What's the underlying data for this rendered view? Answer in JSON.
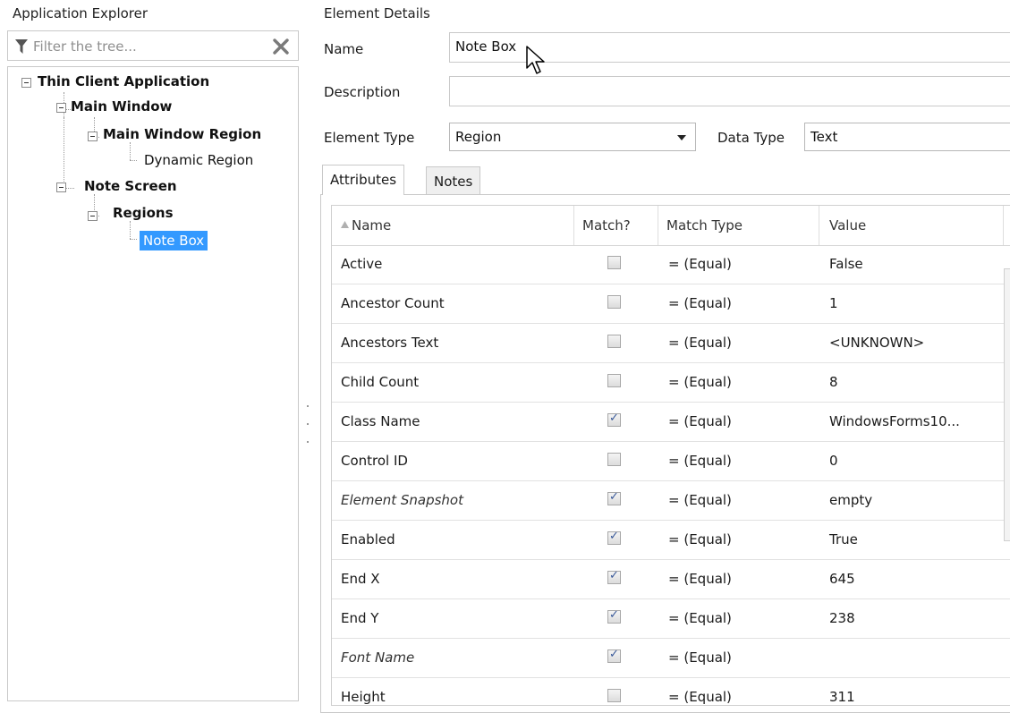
{
  "left_panel": {
    "title": "Application Explorer",
    "filter_placeholder": "Filter the tree...",
    "tree": [
      {
        "label": "Thin Client Application",
        "bold": true,
        "level": 0,
        "expanded": true
      },
      {
        "label": "Main Window",
        "bold": true,
        "level": 1,
        "expanded": true
      },
      {
        "label": "Main Window Region",
        "bold": true,
        "level": 2,
        "expanded": true
      },
      {
        "label": "Dynamic Region",
        "bold": false,
        "level": 3
      },
      {
        "label": "Note Screen",
        "bold": true,
        "level": 1,
        "expanded": true
      },
      {
        "label": "Regions",
        "bold": true,
        "level": 2,
        "expanded": true
      },
      {
        "label": "Note Box",
        "bold": false,
        "level": 3,
        "selected": true
      }
    ]
  },
  "details": {
    "title": "Element Details",
    "name_label": "Name",
    "name_value": "Note Box",
    "description_label": "Description",
    "description_value": "",
    "element_type_label": "Element Type",
    "element_type_value": "Region",
    "data_type_label": "Data Type",
    "data_type_value": "Text"
  },
  "tabs": [
    {
      "label": "Attributes",
      "active": true
    },
    {
      "label": "Notes",
      "active": false
    }
  ],
  "grid": {
    "columns": [
      "Name",
      "Match?",
      "Match Type",
      "Value"
    ],
    "sort_indicator": "sort-ascending-icon",
    "rows": [
      {
        "name": "Active",
        "italic": false,
        "match": false,
        "match_type": "=  (Equal)",
        "value": "False"
      },
      {
        "name": "Ancestor Count",
        "italic": false,
        "match": false,
        "match_type": "=  (Equal)",
        "value": "1"
      },
      {
        "name": "Ancestors Text",
        "italic": false,
        "match": false,
        "match_type": "=  (Equal)",
        "value": "<UNKNOWN>"
      },
      {
        "name": "Child Count",
        "italic": false,
        "match": false,
        "match_type": "=  (Equal)",
        "value": "8"
      },
      {
        "name": "Class Name",
        "italic": false,
        "match": true,
        "match_type": "=  (Equal)",
        "value": "WindowsForms10..."
      },
      {
        "name": "Control ID",
        "italic": false,
        "match": false,
        "match_type": "=  (Equal)",
        "value": "0"
      },
      {
        "name": "Element Snapshot",
        "italic": true,
        "match": true,
        "match_type": "=  (Equal)",
        "value": "empty"
      },
      {
        "name": "Enabled",
        "italic": false,
        "match": true,
        "match_type": "=  (Equal)",
        "value": "True"
      },
      {
        "name": "End X",
        "italic": false,
        "match": true,
        "match_type": "=  (Equal)",
        "value": "645"
      },
      {
        "name": "End Y",
        "italic": false,
        "match": true,
        "match_type": "=  (Equal)",
        "value": "238"
      },
      {
        "name": "Font Name",
        "italic": true,
        "match": true,
        "match_type": "=  (Equal)",
        "value": ""
      },
      {
        "name": "Height",
        "italic": false,
        "match": false,
        "match_type": "=  (Equal)",
        "value": "311"
      }
    ]
  },
  "colors": {
    "selection": "#3399ff",
    "border": "#c9c9c9",
    "checkmark": "#3a5a9a"
  }
}
